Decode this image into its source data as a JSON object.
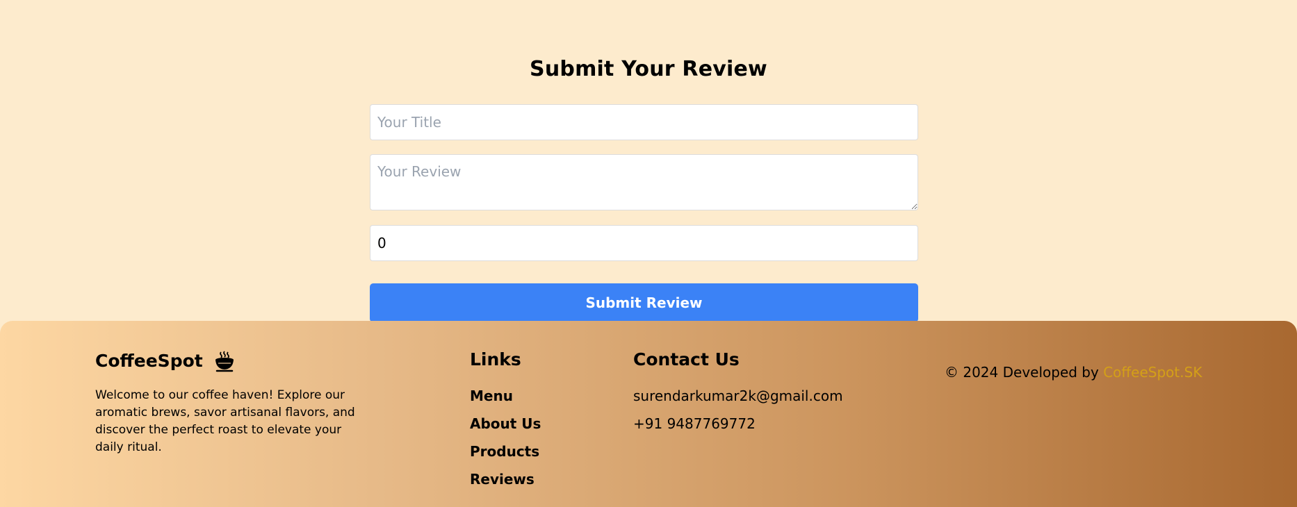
{
  "review_form": {
    "heading": "Submit Your Review",
    "title_placeholder": "Your Title",
    "review_placeholder": "Your Review",
    "rating_value": "0",
    "submit_label": "Submit Review"
  },
  "footer": {
    "brand_name": "CoffeeSpot",
    "brand_icon": "coffee-cup-icon",
    "description": "Welcome to our coffee haven! Explore our aromatic brews, savor artisanal flavors, and discover the perfect roast to elevate your daily ritual.",
    "links_heading": "Links",
    "links": [
      "Menu",
      "About Us",
      "Products",
      "Reviews"
    ],
    "contact_heading": "Contact Us",
    "contact_email": "surendarkumar2k@gmail.com",
    "contact_phone": "+91 9487769772",
    "copyright_prefix": "© 2024 Developed by",
    "developer_name": "CoffeeSpot.SK"
  },
  "colors": {
    "page_background": "#fdebcd",
    "submit_button": "#3b82f6",
    "developer_link": "#d4a017",
    "footer_gradient_start": "#fdd7a3",
    "footer_gradient_end": "#a86830"
  }
}
